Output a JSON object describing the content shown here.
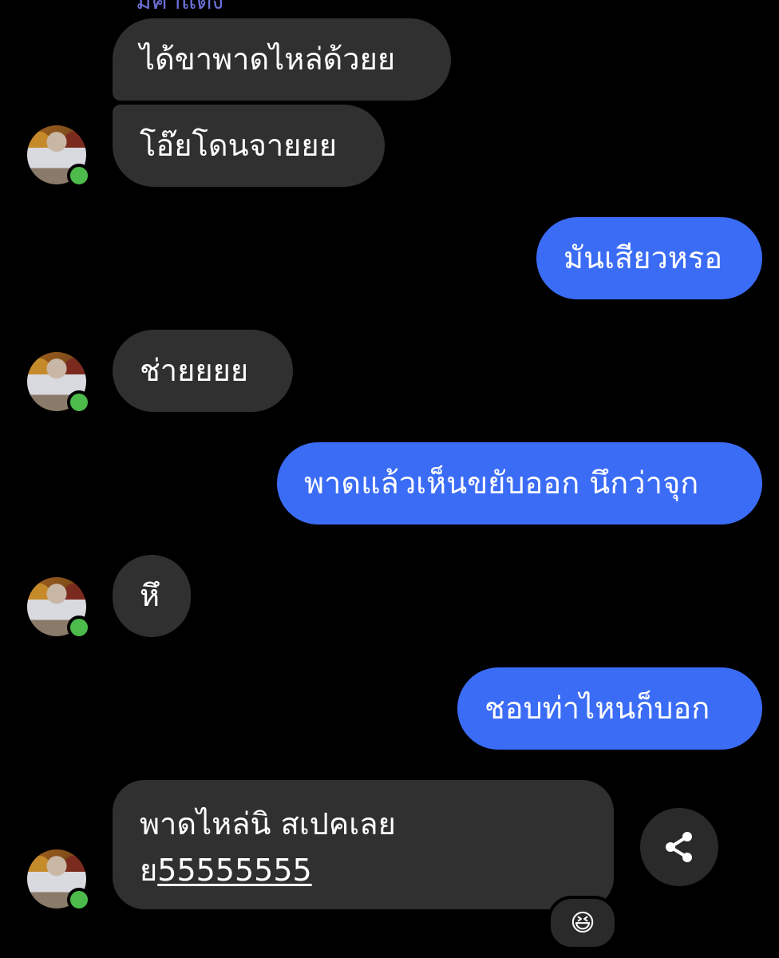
{
  "thread": {
    "sender_name_partial": "มีคำแต่ง"
  },
  "messages": [
    {
      "direction": "in",
      "text": "ได้ขาพาดไหล่ด้วยย"
    },
    {
      "direction": "in",
      "text": "โอ๊ยโดนจายยย"
    },
    {
      "direction": "out",
      "text": "มันเสียวหรอ"
    },
    {
      "direction": "in",
      "text": "ช่ายยยย"
    },
    {
      "direction": "out",
      "text": "พาดแล้วเห็นขยับออก นึกว่าจุก"
    },
    {
      "direction": "in",
      "text": "หึ"
    },
    {
      "direction": "out",
      "text": "ชอบท่าไหนก็บอก"
    },
    {
      "direction": "in",
      "line1": "พาดไหล่นิ สเปคเลย",
      "line2_prefix": "ย",
      "line2_link": "55555555"
    }
  ],
  "reaction": {
    "emoji": "😆"
  },
  "icons": {
    "share": "share-icon",
    "online_status": "online-dot-icon"
  },
  "colors": {
    "background": "#000000",
    "incoming_bubble": "#303030",
    "outgoing_bubble": "#3b6cf6",
    "online_dot": "#4cbb4c"
  }
}
